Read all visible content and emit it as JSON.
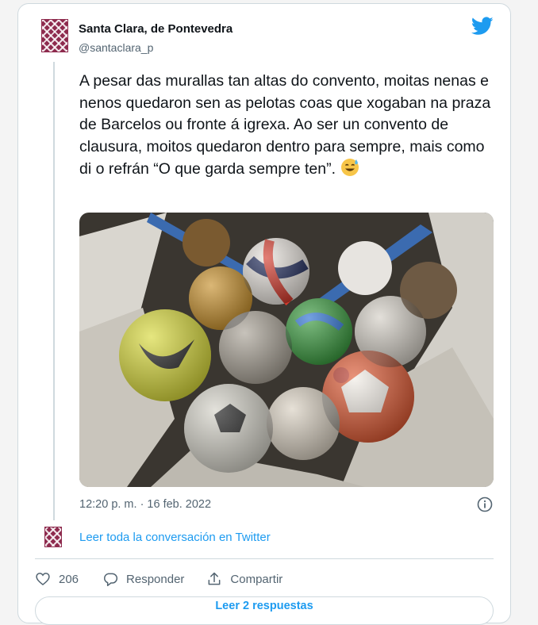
{
  "author": {
    "name": "Santa Clara, de Pontevedra",
    "handle": "@santaclara_p"
  },
  "tweet": {
    "text": "A pesar das murallas tan altas do convento, moitas nenas e nenos quedaron sen as pelotas coas que xogaban na praza de Barcelos ou fronte á igrexa. Ao ser un convento de clausura, moitos quedaron dentro para sempre, mais como di o refrán “O que garda sempre ten”.",
    "emoji": "sweat-smile-emoji",
    "timestamp": "12:20 p. m. · 16 feb. 2022"
  },
  "links": {
    "read_conversation": "Leer toda la conversación en Twitter",
    "more_replies": "Leer 2 respuestas"
  },
  "actions": {
    "like_count": "206",
    "reply_label": "Responder",
    "share_label": "Compartir"
  },
  "colors": {
    "accent": "#1d9bf0",
    "avatar": "#8e2b4e",
    "muted": "#536471",
    "border": "#cfd9de"
  },
  "icons": [
    "twitter-bird-icon",
    "info-icon",
    "heart-icon",
    "reply-icon",
    "share-icon"
  ]
}
